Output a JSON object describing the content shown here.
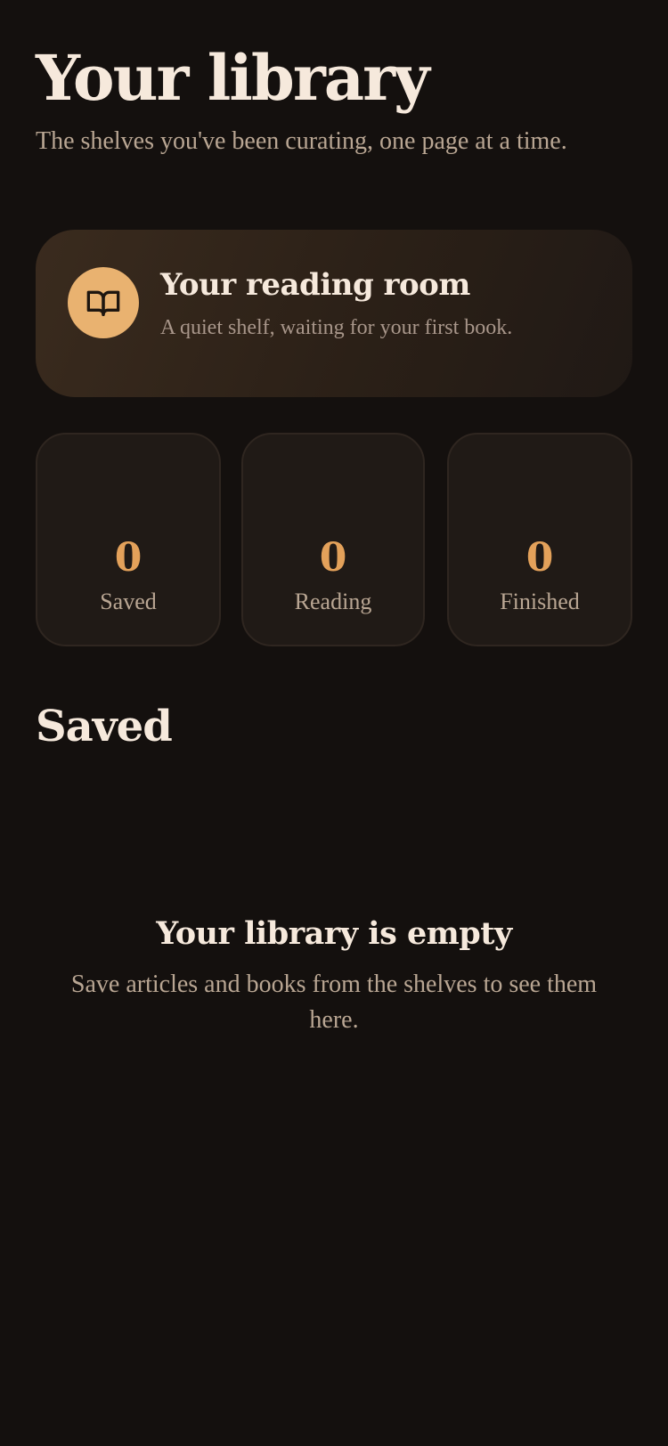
{
  "header": {
    "title": "Your library",
    "subtitle": "The shelves you've been curating, one page at a time."
  },
  "hero": {
    "icon": "book-open-icon",
    "title": "Your reading room",
    "subtitle": "A quiet shelf, waiting for your first book."
  },
  "stats": [
    {
      "value": "0",
      "label": "Saved"
    },
    {
      "value": "0",
      "label": "Reading"
    },
    {
      "value": "0",
      "label": "Finished"
    }
  ],
  "section": {
    "title": "Saved"
  },
  "empty_state": {
    "title": "Your library is empty",
    "subtitle": "Save articles and books from the shelves to see them here."
  },
  "colors": {
    "background": "#14100e",
    "accent": "#e3a15a",
    "icon_badge": "#e9b270",
    "card": "#201a16"
  }
}
